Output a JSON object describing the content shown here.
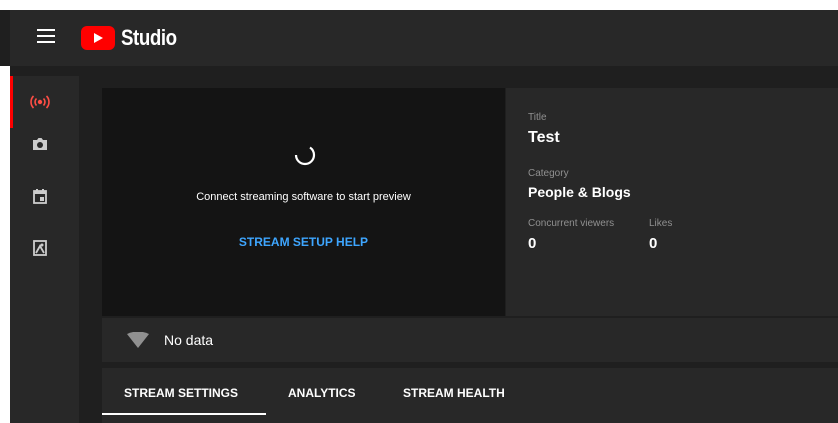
{
  "header": {
    "logo_text": "Studio"
  },
  "sidebar": {
    "items": [
      {
        "name": "live-icon",
        "active": true
      },
      {
        "name": "camera-icon",
        "active": false
      },
      {
        "name": "calendar-icon",
        "active": false
      },
      {
        "name": "manage-icon",
        "active": false
      }
    ]
  },
  "preview": {
    "message": "Connect streaming software to start preview",
    "help_link": "STREAM SETUP HELP"
  },
  "info": {
    "title_label": "Title",
    "title_value": "Test",
    "category_label": "Category",
    "category_value": "People & Blogs",
    "viewers_label": "Concurrent viewers",
    "viewers_value": "0",
    "likes_label": "Likes",
    "likes_value": "0"
  },
  "status": {
    "text": "No data"
  },
  "tabs": [
    {
      "label": "STREAM SETTINGS",
      "selected": true
    },
    {
      "label": "ANALYTICS",
      "selected": false
    },
    {
      "label": "STREAM HEALTH",
      "selected": false
    }
  ],
  "colors": {
    "accent_red": "#ff0000",
    "link_blue": "#3ea6ff",
    "background": "#1f1f1f",
    "panel": "#282828",
    "preview_bg": "#141414"
  }
}
